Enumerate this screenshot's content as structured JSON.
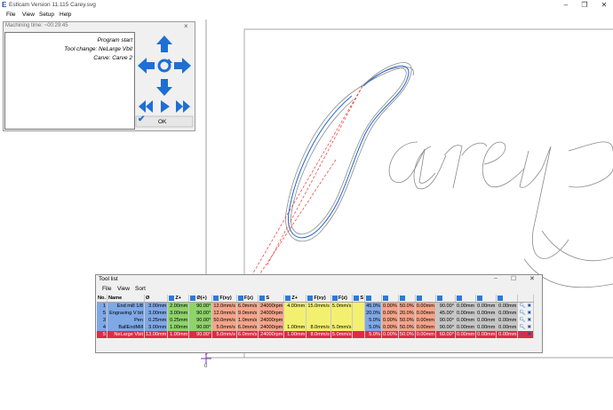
{
  "window": {
    "title": "Estlcam Version 11.115 Carey.svg",
    "logo": "E",
    "controls": [
      "minimize-icon",
      "maximize-icon",
      "close-icon"
    ]
  },
  "menu": [
    "File",
    "View",
    "Setup",
    "Help"
  ],
  "machining": {
    "title": "Machining time: ~00:29:45",
    "log": [
      "Program start",
      "Tool change: NeLarge Vbit",
      "Carve: Carve 2"
    ],
    "ok_label": "OK",
    "close": "×",
    "colors": {
      "arrow": "#1e6fd4"
    }
  },
  "toollist": {
    "title": "Tool list",
    "menu": [
      "File",
      "View",
      "Sort"
    ],
    "headers": [
      "No.",
      "Name",
      "Ø",
      "Z+",
      "Ø(+)",
      "F(xy)",
      "F(z)",
      "S",
      "Z+",
      "F(xy)",
      "F(z)",
      "S",
      "",
      "",
      "",
      "",
      "",
      "",
      "",
      "",
      ""
    ],
    "rows": [
      {
        "no": "1",
        "name": "End mill 1/8",
        "dia": "3.00mm",
        "z1": "2.00mm",
        "angle": "90.00°",
        "fxy": "12.0mm/s",
        "fz": "6.0mm/s",
        "s": "24000rpm",
        "z2": "4.00mm",
        "fxy2": "15.0mm/s",
        "fz2": "5.0mm/s",
        "p1": "45.0%",
        "c1": "0.00%",
        "c2": "50.0%",
        "c3": "0.00mm",
        "c4": "90.00°",
        "c5": "0.00mm",
        "c6": "0.00mm",
        "c7": "0.00mm"
      },
      {
        "no": "5",
        "name": "Engraving V bit",
        "dia": "3.00mm",
        "z1": "3.00mm",
        "angle": "90.00°",
        "fxy": "12.0mm/s",
        "fz": "9.0mm/s",
        "s": "24000rpm",
        "z2": "",
        "fxy2": "",
        "fz2": "",
        "p1": "20.0%",
        "c1": "0.00%",
        "c2": "20.0%",
        "c3": "0.00mm",
        "c4": "45.00°",
        "c5": "0.00mm",
        "c6": "0.00mm",
        "c7": "0.00mm"
      },
      {
        "no": "3",
        "name": "Pen",
        "dia": "0.25mm",
        "z1": "0.25mm",
        "angle": "90.00°",
        "fxy": "50.0mm/s",
        "fz": "1.0mm/s",
        "s": "24000rpm",
        "z2": "",
        "fxy2": "",
        "fz2": "",
        "p1": "5.0%",
        "c1": "0.00%",
        "c2": "50.0%",
        "c3": "0.00mm",
        "c4": "90.00°",
        "c5": "0.00mm",
        "c6": "0.00mm",
        "c7": "0.00mm"
      },
      {
        "no": "4",
        "name": "BallEndMill",
        "dia": "3.00mm",
        "z1": "1.00mm",
        "angle": "90.00°",
        "fxy": "5.0mm/s",
        "fz": "6.0mm/s",
        "s": "24000rpm",
        "z2": "1.00mm",
        "fxy2": "8.0mm/s",
        "fz2": "5.0mm/s",
        "p1": "5.0%",
        "c1": "0.00%",
        "c2": "50.0%",
        "c3": "0.00mm",
        "c4": "90.00°",
        "c5": "0.00mm",
        "c6": "0.00mm",
        "c7": "0.00mm"
      },
      {
        "no": "5",
        "name": "NeLarge Vbit",
        "dia": "13.00mm",
        "z1": "1.00mm",
        "angle": "90.00°",
        "fxy": "5.0mm/s",
        "fz": "6.0mm/s",
        "s": "24000rpm",
        "z2": "1.00mm",
        "fxy2": "8.0mm/s",
        "fz2": "5.0mm/s",
        "p1": "5.0%",
        "c1": "0.00%",
        "c2": "50.0%",
        "c3": "0.00mm",
        "c4": "60.00°",
        "c5": "0.00mm",
        "c6": "0.00mm",
        "c7": "0.00mm"
      }
    ],
    "selected_row": 4,
    "colors": {
      "blue": "#7fa8e6",
      "green": "#8fd36b",
      "salmon": "#f4a58a",
      "yellow": "#f3f06f",
      "red": "#e12a45",
      "grey": "#c6c6c6"
    }
  }
}
